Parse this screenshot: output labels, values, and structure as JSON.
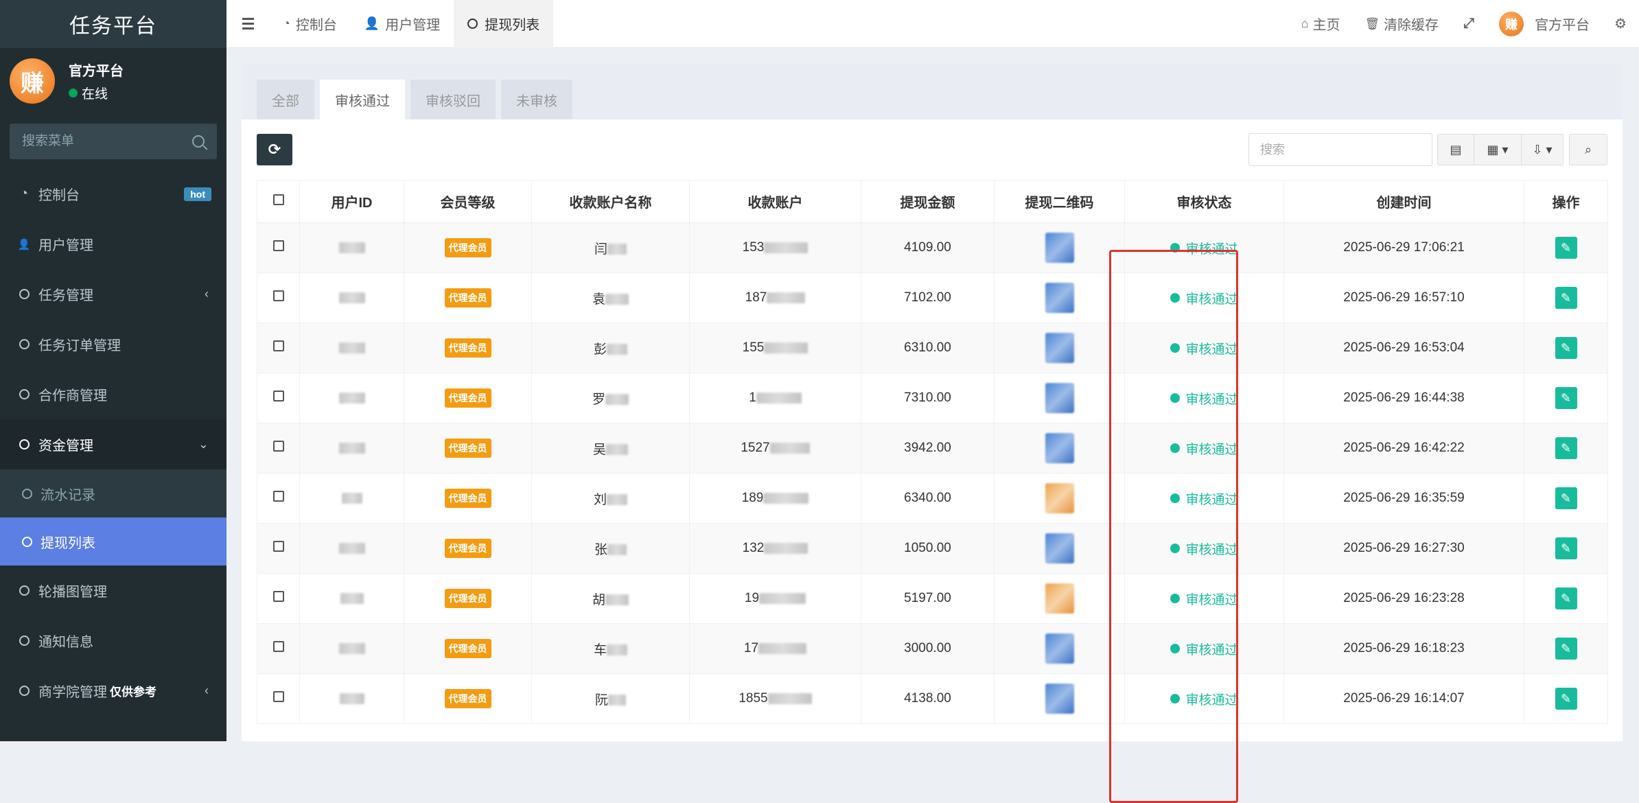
{
  "app": {
    "title": "任务平台"
  },
  "user": {
    "name": "官方平台",
    "status": "在线",
    "avatar_char": "赚"
  },
  "sidebar": {
    "search_placeholder": "搜索菜单",
    "items": [
      {
        "label": "控制台",
        "icon": "dashboard-icon",
        "badge": "hot"
      },
      {
        "label": "用户管理",
        "icon": "user-icon"
      },
      {
        "label": "任务管理",
        "icon": "circle-icon",
        "chevron": "‹"
      },
      {
        "label": "任务订单管理",
        "icon": "circle-icon"
      },
      {
        "label": "合作商管理",
        "icon": "circle-icon"
      },
      {
        "label": "资金管理",
        "icon": "circle-icon",
        "chevron": "⌄",
        "open": true,
        "children": [
          {
            "label": "流水记录"
          },
          {
            "label": "提现列表",
            "active": true
          }
        ]
      },
      {
        "label": "轮播图管理",
        "icon": "circle-icon"
      },
      {
        "label": "通知信息",
        "icon": "circle-icon"
      },
      {
        "label": "商学院管理",
        "icon": "circle-icon",
        "chevron": "‹",
        "tag": "仅供参考"
      }
    ]
  },
  "topnav": {
    "tabs": [
      {
        "label": "控制台",
        "icon": "dashboard-icon"
      },
      {
        "label": "用户管理",
        "icon": "user-icon"
      },
      {
        "label": "提现列表",
        "icon": "circle-icon",
        "active": true
      }
    ],
    "right": {
      "home": "主页",
      "clear_cache": "清除缓存",
      "account": "官方平台"
    }
  },
  "content_tabs": [
    {
      "label": "全部"
    },
    {
      "label": "审核通过",
      "active": true
    },
    {
      "label": "审核驳回"
    },
    {
      "label": "未审核"
    }
  ],
  "toolbar": {
    "search_placeholder": "搜索"
  },
  "table": {
    "columns": [
      "用户ID",
      "会员等级",
      "收款账户名称",
      "收款账户",
      "提现金额",
      "提现二维码",
      "审核状态",
      "创建时间",
      "操作"
    ],
    "rows": [
      {
        "level": "代理会员",
        "name_prefix": "闫",
        "account_prefix": "153",
        "amount": "4109.00",
        "qr": "blue",
        "status": "审核通过",
        "created": "2025-06-29 17:06:21"
      },
      {
        "level": "代理会员",
        "name_prefix": "袁",
        "account_prefix": "187",
        "amount": "7102.00",
        "qr": "blue",
        "status": "审核通过",
        "created": "2025-06-29 16:57:10"
      },
      {
        "level": "代理会员",
        "name_prefix": "彭",
        "account_prefix": "155",
        "amount": "6310.00",
        "qr": "blue",
        "status": "审核通过",
        "created": "2025-06-29 16:53:04"
      },
      {
        "level": "代理会员",
        "name_prefix": "罗",
        "account_prefix": "1",
        "amount": "7310.00",
        "qr": "blue",
        "status": "审核通过",
        "created": "2025-06-29 16:44:38"
      },
      {
        "level": "代理会员",
        "name_prefix": "吴",
        "account_prefix": "1527",
        "amount": "3942.00",
        "qr": "blue",
        "status": "审核通过",
        "created": "2025-06-29 16:42:22"
      },
      {
        "level": "代理会员",
        "name_prefix": "刘",
        "account_prefix": "189",
        "amount": "6340.00",
        "qr": "orange",
        "status": "审核通过",
        "created": "2025-06-29 16:35:59"
      },
      {
        "level": "代理会员",
        "name_prefix": "张",
        "account_prefix": "132",
        "amount": "1050.00",
        "qr": "blue",
        "status": "审核通过",
        "created": "2025-06-29 16:27:30"
      },
      {
        "level": "代理会员",
        "name_prefix": "胡",
        "account_prefix": "19",
        "amount": "5197.00",
        "qr": "orange",
        "status": "审核通过",
        "created": "2025-06-29 16:23:28"
      },
      {
        "level": "代理会员",
        "name_prefix": "车",
        "account_prefix": "17",
        "amount": "3000.00",
        "qr": "blue",
        "status": "审核通过",
        "created": "2025-06-29 16:18:23"
      },
      {
        "level": "代理会员",
        "name_prefix": "阮",
        "account_prefix": "1855",
        "amount": "4138.00",
        "qr": "blue",
        "status": "审核通过",
        "created": "2025-06-29 16:14:07"
      }
    ]
  }
}
